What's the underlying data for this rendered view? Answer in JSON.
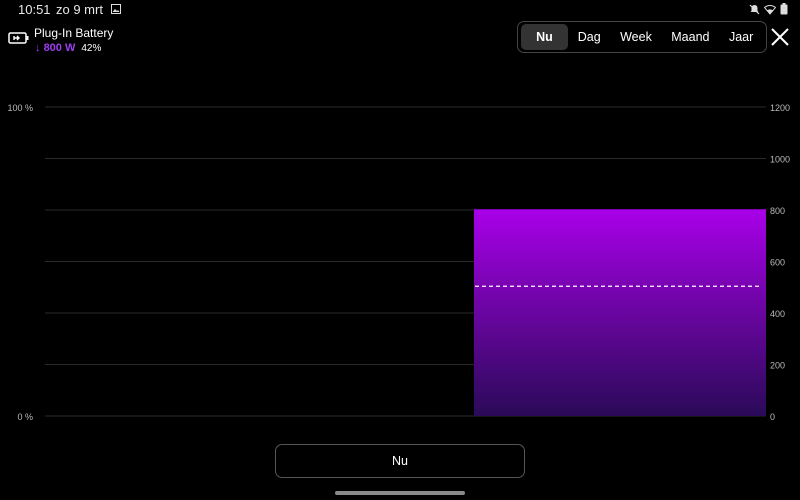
{
  "status_bar": {
    "time": "10:51",
    "date": "zo 9 mrt",
    "icons": [
      "image-icon",
      "mute-icon",
      "wifi-icon",
      "battery-status-icon"
    ]
  },
  "header": {
    "device_name": "Plug-In Battery",
    "power_arrow": "↓",
    "power": "800 W",
    "state_of_charge": "42%",
    "accent_color": "#9d3df0"
  },
  "tabs": [
    {
      "label": "Nu",
      "active": true
    },
    {
      "label": "Dag",
      "active": false
    },
    {
      "label": "Week",
      "active": false
    },
    {
      "label": "Maand",
      "active": false
    },
    {
      "label": "Jaar",
      "active": false
    }
  ],
  "bottom_button": {
    "label": "Nu"
  },
  "chart_data": {
    "type": "bar",
    "left_axis": {
      "ticks": [
        "100 %",
        "0 %"
      ],
      "range": [
        0,
        100
      ]
    },
    "right_axis": {
      "ticks": [
        "1200",
        "1000",
        "800",
        "600",
        "400",
        "200",
        "0"
      ],
      "range": [
        0,
        1200
      ]
    },
    "bar": {
      "value": 800,
      "unit": "W",
      "x_start_fraction": 0.595
    },
    "soc_line": {
      "value": 42,
      "unit": "%"
    },
    "grid": true,
    "colors": {
      "bar_top": "#a800e8",
      "bar_bottom": "#2a0a58",
      "grid": "#2a2a2a",
      "soc_line": "#ffffff"
    }
  }
}
